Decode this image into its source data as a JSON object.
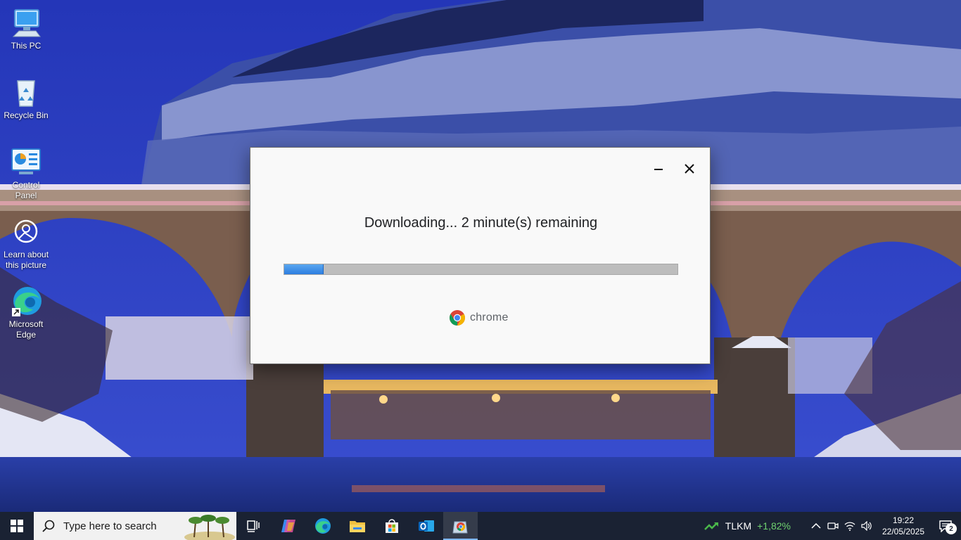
{
  "desktop": {
    "icons": [
      {
        "label": "This PC",
        "icon": "this-pc-icon"
      },
      {
        "label": "Recycle Bin",
        "icon": "recycle-bin-icon"
      },
      {
        "label": "Control Panel",
        "icon": "control-panel-icon"
      },
      {
        "label": "Learn about this picture",
        "icon": "camera-icon"
      },
      {
        "label": "Microsoft Edge",
        "icon": "edge-icon"
      }
    ]
  },
  "dialog": {
    "status": "Downloading... 2 minute(s) remaining",
    "progress": 0.1,
    "brand": "chrome",
    "minimize_icon": "minimize-icon",
    "close_icon": "close-icon"
  },
  "taskbar": {
    "search_placeholder": "Type here to search",
    "apps": [
      "task-view-icon",
      "copilot-icon",
      "edge-icon",
      "file-explorer-icon",
      "microsoft-store-icon",
      "outlook-icon",
      "chrome-installer-icon"
    ],
    "active_app": "chrome-installer-icon",
    "stock": {
      "symbol": "TLKM",
      "change": "+1,82%",
      "color": "#6fd26f"
    },
    "clock": {
      "time": "19:22",
      "date": "22/05/2025"
    },
    "notifications": "2"
  },
  "colors": {
    "accent": "#2d7ee0",
    "taskbar": "#1a2233",
    "dialog_bg": "#f9f9f9"
  }
}
